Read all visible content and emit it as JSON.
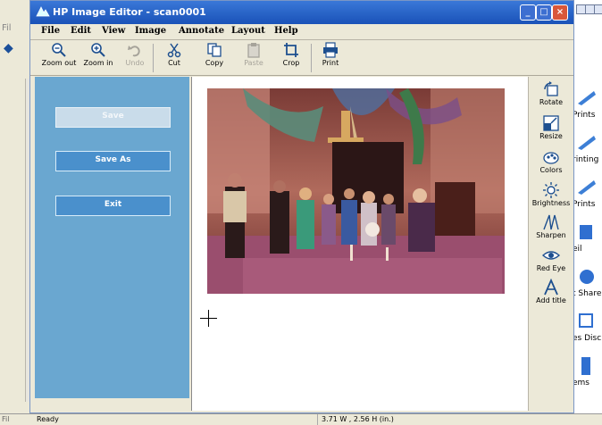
{
  "window": {
    "title": "HP Image Editor - scan0001",
    "controls": {
      "minimize": "_",
      "maximize": "□",
      "close": "×"
    }
  },
  "menu": [
    "File",
    "Edit",
    "View",
    "Image",
    "Annotate",
    "Layout",
    "Help"
  ],
  "toolbar": [
    {
      "label": "Zoom out",
      "icon": "zoom-out-icon",
      "enabled": true
    },
    {
      "label": "Zoom in",
      "icon": "zoom-in-icon",
      "enabled": true
    },
    {
      "label": "Undo",
      "icon": "undo-icon",
      "enabled": false
    },
    {
      "label": "Cut",
      "icon": "cut-icon",
      "enabled": true
    },
    {
      "label": "Copy",
      "icon": "copy-icon",
      "enabled": true
    },
    {
      "label": "Paste",
      "icon": "paste-icon",
      "enabled": false
    },
    {
      "label": "Crop",
      "icon": "crop-icon",
      "enabled": true
    },
    {
      "label": "Print",
      "icon": "print-icon",
      "enabled": true
    }
  ],
  "left_panel": {
    "save_label": "Save",
    "save_enabled": false,
    "save_as_label": "Save As",
    "exit_label": "Exit"
  },
  "right_tools": [
    {
      "label": "Rotate",
      "icon": "rotate-icon"
    },
    {
      "label": "Resize",
      "icon": "resize-icon"
    },
    {
      "label": "Colors",
      "icon": "colors-icon"
    },
    {
      "label": "Brightness",
      "icon": "brightness-icon"
    },
    {
      "label": "Sharpen",
      "icon": "sharpen-icon"
    },
    {
      "label": "Red Eye",
      "icon": "red-eye-icon"
    },
    {
      "label": "Add title",
      "icon": "add-title-icon"
    }
  ],
  "background_app": {
    "left_menu_fragment": "Fil",
    "left_status_fragment": "Ready",
    "right_items": [
      "Prints",
      "rinting",
      "Prints",
      "eil",
      "t Share",
      "es Disc",
      "ems"
    ]
  },
  "status": {
    "ready": "Ready",
    "size": "3.71 W , 2.56 H (in.)"
  },
  "colors": {
    "title_bar": "#2a62c8",
    "left_panel": "#6aa7d0",
    "window_face": "#ece9d8"
  }
}
